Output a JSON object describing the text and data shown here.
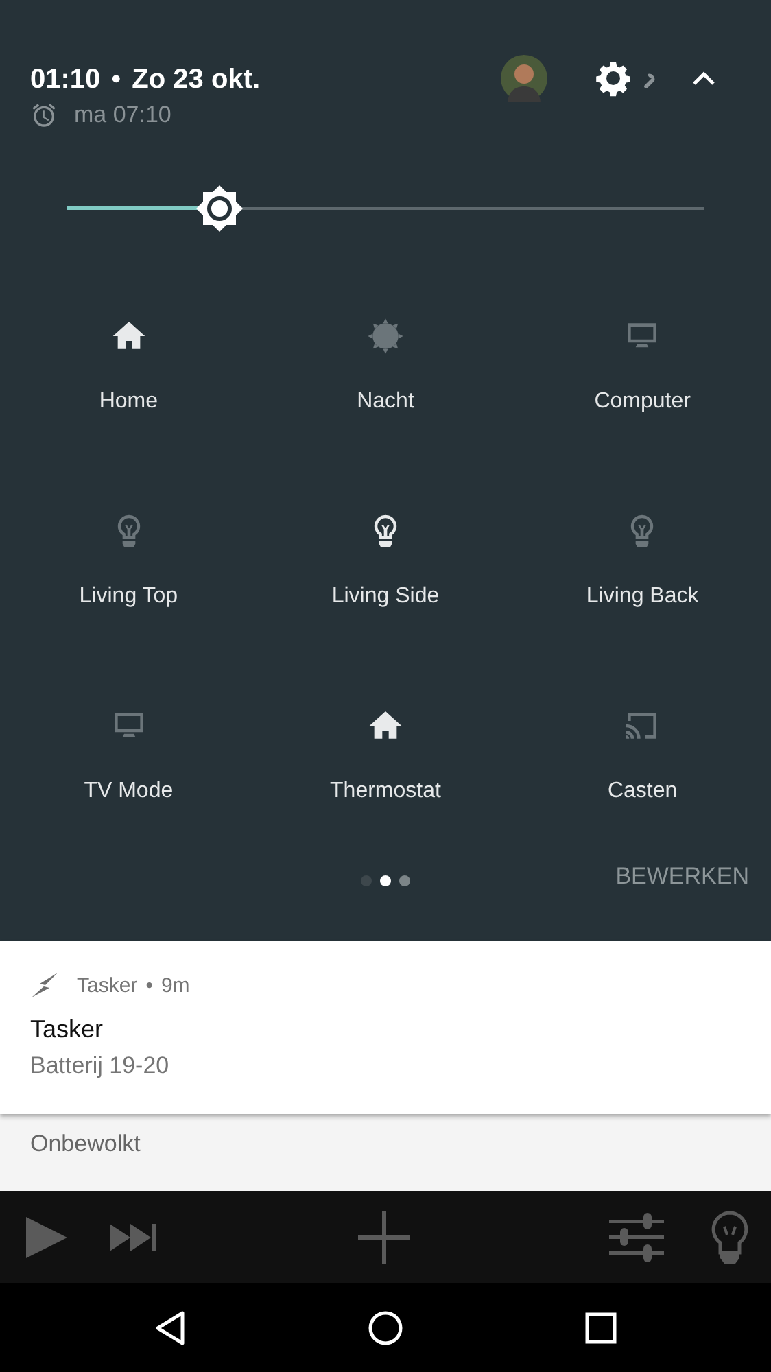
{
  "header": {
    "time": "01:10",
    "separator": "•",
    "date": "Zo 23 okt.",
    "alarm": "ma 07:10"
  },
  "brightness": {
    "level": 0.24
  },
  "tiles": [
    {
      "label": "Home",
      "kind": "home",
      "on": true
    },
    {
      "label": "Nacht",
      "kind": "sun",
      "on": false
    },
    {
      "label": "Computer",
      "kind": "monitor",
      "on": false
    },
    {
      "label": "Living Top",
      "kind": "bulb",
      "on": false
    },
    {
      "label": "Living Side",
      "kind": "bulb",
      "on": true
    },
    {
      "label": "Living Back",
      "kind": "bulb",
      "on": false
    },
    {
      "label": "TV Mode",
      "kind": "monitor",
      "on": false
    },
    {
      "label": "Thermostat",
      "kind": "home",
      "on": true
    },
    {
      "label": "Casten",
      "kind": "cast",
      "on": false
    }
  ],
  "pages": [
    {
      "selected": false
    },
    {
      "selected": true
    },
    {
      "selected": false
    }
  ],
  "edit_button": "BEWERKEN",
  "notification": {
    "app": "Tasker",
    "separator": "•",
    "age": "9m",
    "title": "Tasker",
    "text": "Batterij 19-20"
  },
  "weather": {
    "text": "Onbewolkt"
  }
}
